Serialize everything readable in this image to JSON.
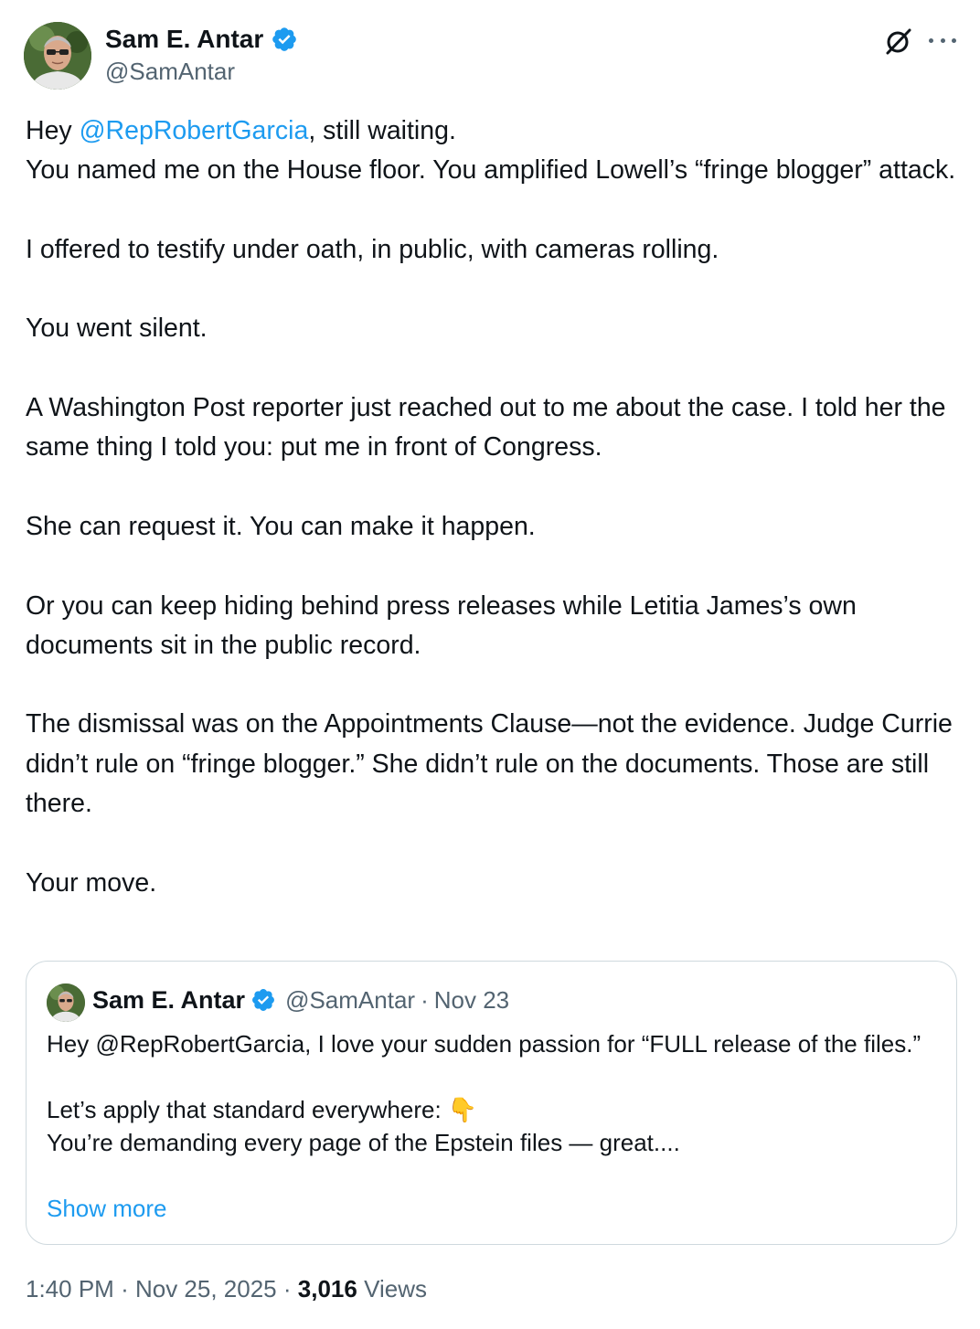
{
  "author": {
    "name": "Sam E. Antar",
    "handle": "@SamAntar"
  },
  "icons": {
    "verified": "verified-badge-icon",
    "grok": "grok-icon",
    "more": "more-icon"
  },
  "colors": {
    "accent": "#1d9bf0",
    "text": "#0f1419",
    "secondary": "#536471",
    "border": "#cfd9de"
  },
  "tweet": {
    "p1_pre": "Hey ",
    "p1_mention": "@RepRobertGarcia",
    "p1_post": ", still waiting.",
    "p1_line2": "You named me on the House floor. You amplified Lowell’s “fringe blogger” attack.",
    "p2": "I offered to testify under oath, in public, with cameras rolling.",
    "p3": "You went silent.",
    "p4": "A Washington Post reporter just reached out to me about the case. I told her the same thing I told you: put me in front of Congress.",
    "p5": "She can request it. You can make it happen.",
    "p6": "Or you can keep hiding behind press releases while Letitia James’s own documents sit in the public record.",
    "p7": "The dismissal was on the Appointments Clause—not the evidence. Judge Currie didn’t rule on “fringe blogger.” She didn’t rule on the documents. Those are still there.",
    "p8": "Your move."
  },
  "quote": {
    "name": "Sam E. Antar",
    "handle": "@SamAntar",
    "separator": "·",
    "date": "Nov 23",
    "line1": "Hey @RepRobertGarcia, I love your sudden passion for “FULL release of the files.”",
    "line2": "Let’s apply that standard everywhere: 👇",
    "line3": "You’re demanding every page of the Epstein files — great....",
    "show_more": "Show more"
  },
  "footer": {
    "time": "1:40 PM",
    "sep1": "·",
    "date": "Nov 25, 2025",
    "sep2": "·",
    "views_count": "3,016",
    "views_label": "Views"
  }
}
